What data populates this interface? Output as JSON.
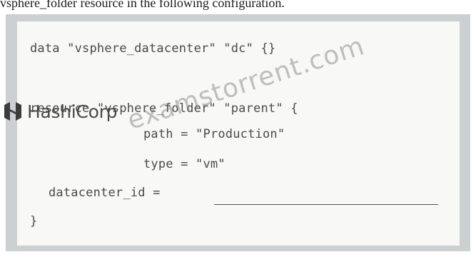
{
  "caption": "vsphere_folder resource in the following configuration.",
  "code": {
    "line1": "data \"vsphere_datacenter\" \"dc\" {}",
    "line2": "resource \"vsphere_folder\" \"parent\" {",
    "line3": "path = \"Production\"",
    "line4": "type = \"vm\"",
    "line5": "datacenter_id =",
    "line6": "}"
  },
  "logo": {
    "text": "HashiCorp",
    "icon": "hashicorp-logo-icon"
  },
  "watermark": "examstorrent.com",
  "colors": {
    "frame": "#cdd0d0",
    "panel": "#f8f8f6",
    "code_text": "#4a4a4a"
  }
}
